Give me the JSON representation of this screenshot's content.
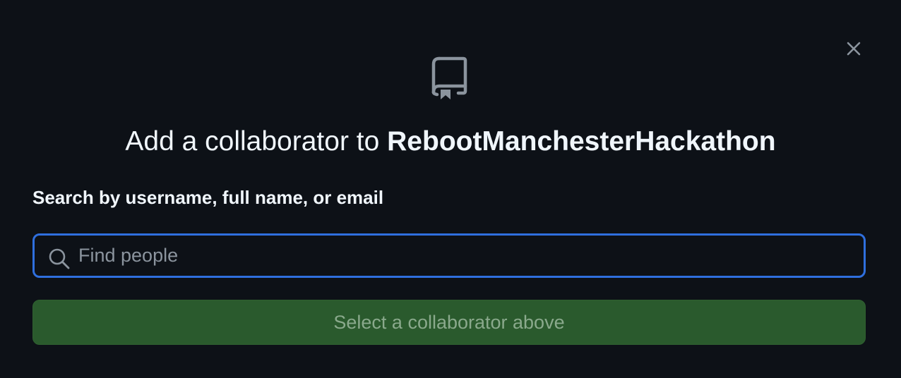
{
  "dialog": {
    "title_prefix": "Add a collaborator to ",
    "repo_name": "RebootManchesterHackathon",
    "close_icon": "close-icon",
    "header_icon": "repo-icon"
  },
  "search": {
    "label": "Search by username, full name, or email",
    "placeholder": "Find people",
    "value": "",
    "icon": "search-icon"
  },
  "submit": {
    "label": "Select a collaborator above",
    "disabled": true
  },
  "colors": {
    "background": "#0d1117",
    "focus_border": "#2f6fde",
    "button_bg": "#2a5a2d",
    "button_text": "#8aa98c",
    "icon_gray": "#8b949e"
  }
}
